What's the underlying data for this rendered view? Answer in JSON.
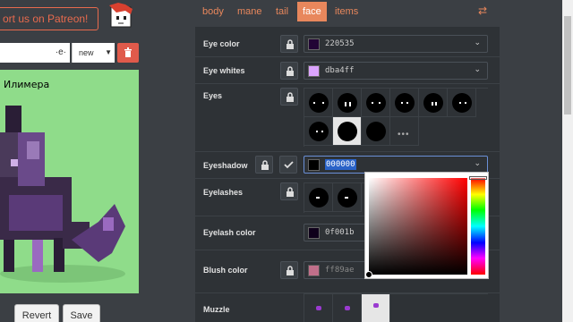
{
  "patreon_label": "ort us on Patreon!",
  "left": {
    "name_value": "",
    "name_dots": "·e·",
    "new_select": "new",
    "preview_name": "Илимера",
    "buttons": {
      "revert": "Revert",
      "save": "Save"
    }
  },
  "tabs": [
    "body",
    "mane",
    "tail",
    "face",
    "items"
  ],
  "active_tab": "face",
  "face": {
    "eye_color": {
      "label": "Eye color",
      "value": "220535",
      "swatch": "#220535"
    },
    "eye_whites": {
      "label": "Eye whites",
      "value": "dba4ff",
      "swatch": "#dba4ff"
    },
    "eyes": {
      "label": "Eyes"
    },
    "eyeshadow": {
      "label": "Eyeshadow",
      "value": "000000",
      "swatch": "#000000"
    },
    "eyelashes": {
      "label": "Eyelashes"
    },
    "eyelash_color": {
      "label": "Eyelash color",
      "value": "0f001b",
      "swatch": "#0f001b"
    },
    "blush_color": {
      "label": "Blush color",
      "value": "ff89ae",
      "swatch": "#ff89ae"
    },
    "muzzle": {
      "label": "Muzzle"
    }
  },
  "colors": {
    "accent": "#e8875c",
    "delete": "#e05a4b",
    "preview_bg": "#8fdc8a"
  }
}
